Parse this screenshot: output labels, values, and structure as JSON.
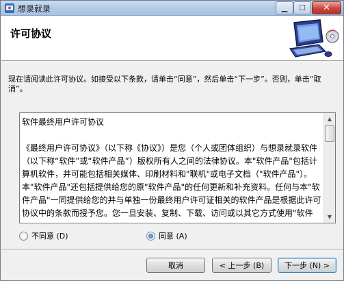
{
  "window": {
    "title": "想录就录"
  },
  "titlebar": {
    "minimize_glyph": "▁",
    "maximize_glyph": "☐",
    "close_glyph": "✕"
  },
  "header": {
    "title": "许可协议"
  },
  "instructions": "现在请阅读此许可协议。如接受以下条款，请单击“同意”，然后单击“下一步”。否则，单击“取消”。",
  "license": {
    "heading": "软件最终用户许可协议",
    "body": "《最终用户许可协议》（以下称《协议》）是您（个人或团体组织）与想录就录软件（以下称“软件”或“软件产品”）版权所有人之间的法律协议。本\"软件产品\"包括计算机软件，并可能包括相关媒体、印刷材料和\"联机\"或电子文档（\"软件产品\"）。本\"软件产品\"还包括提供给您的原\"软件产品\"的任何更新和补充资料。任何与本\"软件产品\"一同提供给您的并与单独一份最终用户许可证相关的软件产品是根据此许可协议中的条款而授予您。您一旦安装、复制、下载、访问或以其它方式使用\"软件"
  },
  "scrollbar": {
    "up_glyph": "▲",
    "down_glyph": "▼"
  },
  "options": {
    "decline_label": "不同意 (D)",
    "accept_label": "同意 (A)",
    "selected": "accept"
  },
  "buttons": {
    "cancel": "取消",
    "back": "< 上一步 (B)",
    "next": "下一步 (N) >"
  }
}
